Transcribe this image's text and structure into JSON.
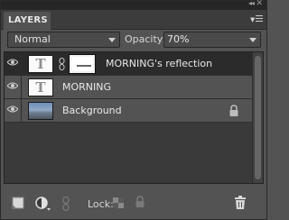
{
  "panel": {
    "tab_label": "LAYERS",
    "collapse_glyph": "◂◂",
    "close_glyph": "✕"
  },
  "controls": {
    "blend_mode": "Normal",
    "opacity_label": "Opacity:",
    "opacity_value": "70%"
  },
  "layers": [
    {
      "name": "MORNING's reflection",
      "visible": true,
      "selected": true,
      "type": "text",
      "has_mask": true
    },
    {
      "name": "MORNING",
      "visible": true,
      "selected": false,
      "type": "text",
      "has_mask": false
    },
    {
      "name": "Background",
      "visible": true,
      "selected": false,
      "type": "image",
      "locked": true
    }
  ],
  "text_thumb_glyph": "T",
  "toolbar": {
    "lock_label": "Lock:",
    "icons": [
      "new-layer-icon",
      "adjustment-layer-icon",
      "link-layers-icon",
      "lock-transparency-icon",
      "lock-all-icon",
      "delete-layer-icon"
    ]
  },
  "colors": {
    "panel_bg": "#535353",
    "selected_row_bg": "#2b2b2b",
    "tab_bar_bg": "#3c3c3c"
  }
}
